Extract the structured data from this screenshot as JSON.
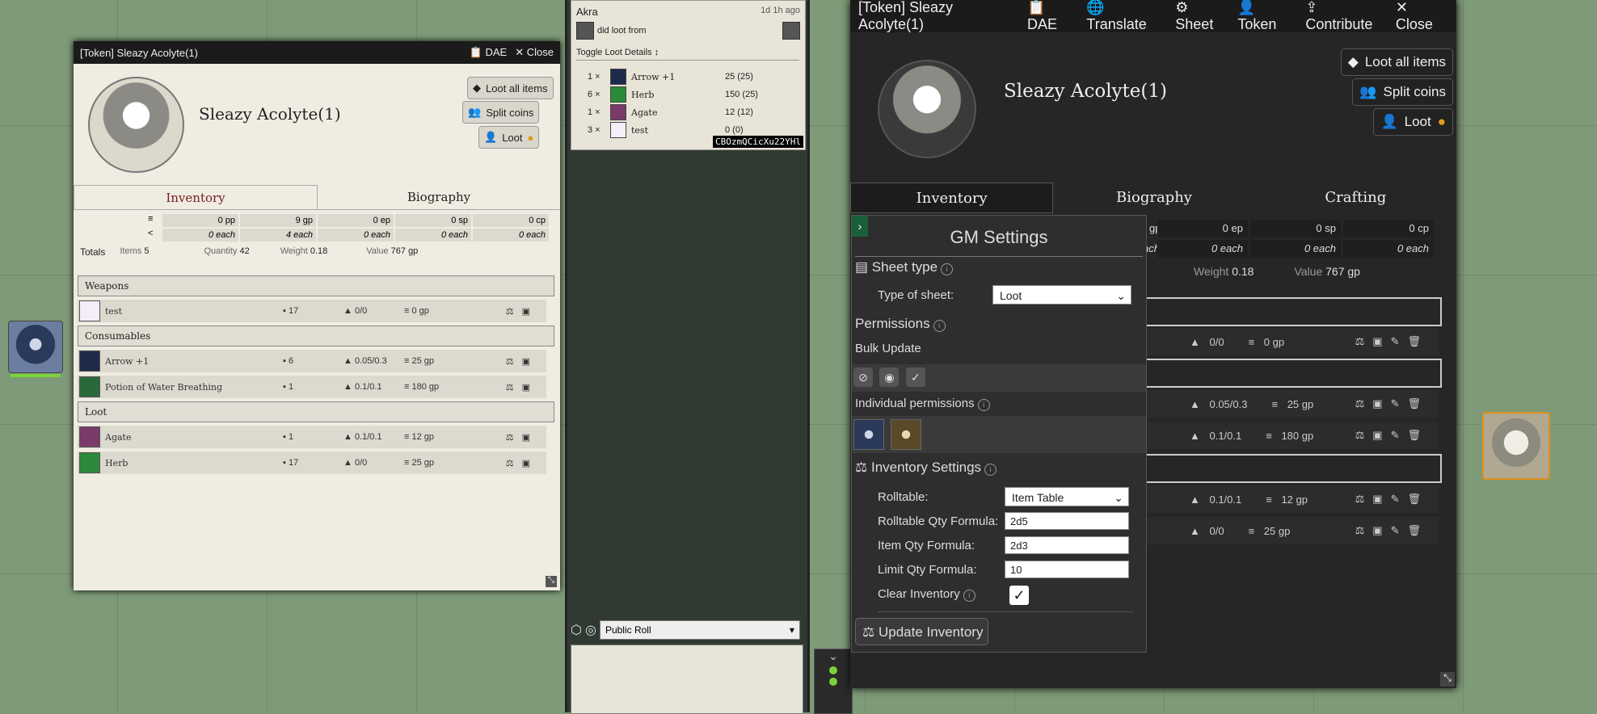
{
  "left_sheet": {
    "title": "[Token] Sleazy Acolyte(1)",
    "dae": "DAE",
    "close": "Close",
    "name": "Sleazy Acolyte(1)",
    "buttons": {
      "loot_all": "Loot all items",
      "split": "Split coins",
      "loot": "Loot"
    },
    "tabs": [
      "Inventory",
      "Biography"
    ],
    "coins": [
      {
        "value": "0",
        "unit": "pp",
        "each": "0 each"
      },
      {
        "value": "9",
        "unit": "gp",
        "each": "4 each"
      },
      {
        "value": "0",
        "unit": "ep",
        "each": "0 each"
      },
      {
        "value": "0",
        "unit": "sp",
        "each": "0 each"
      },
      {
        "value": "0",
        "unit": "cp",
        "each": "0 each"
      }
    ],
    "totals": {
      "label": "Totals",
      "items_label": "Items",
      "items": "5",
      "quantity_label": "Quantity",
      "quantity": "42",
      "weight_label": "Weight",
      "weight": "0.18",
      "value_label": "Value",
      "value": "767 gp"
    },
    "sections": {
      "weapons": "Weapons",
      "consumables": "Consumables",
      "loot": "Loot"
    },
    "items": [
      {
        "name": "test",
        "qty": "17",
        "weight": "0/0",
        "price": "0 gp"
      },
      {
        "name": "Arrow +1",
        "qty": "6",
        "weight": "0.05/0.3",
        "price": "25 gp"
      },
      {
        "name": "Potion of Water Breathing",
        "qty": "1",
        "weight": "0.1/0.1",
        "price": "180 gp"
      },
      {
        "name": "Agate",
        "qty": "1",
        "weight": "0.1/0.1",
        "price": "12 gp"
      },
      {
        "name": "Herb",
        "qty": "17",
        "weight": "0/0",
        "price": "25 gp"
      }
    ]
  },
  "chat": {
    "who": "Akra",
    "time": "1d 1h ago",
    "did": "did loot from",
    "toggle": "Toggle Loot Details ↕",
    "loot": [
      {
        "q": "1 ×",
        "name": "Arrow +1",
        "price": "25 (25)"
      },
      {
        "q": "6 ×",
        "name": "Herb",
        "price": "150 (25)"
      },
      {
        "q": "1 ×",
        "name": "Agate",
        "price": "12 (12)"
      },
      {
        "q": "3 ×",
        "name": "test",
        "price": "0 (0)"
      }
    ],
    "code": "CBOzmQCicXu22YHl",
    "roll_mode": "Public Roll"
  },
  "right_sheet": {
    "title": "[Token] Sleazy Acolyte(1)",
    "header_buttons": [
      "DAE",
      "Translate",
      "Sheet",
      "Token",
      "Contribute",
      "Close"
    ],
    "name": "Sleazy Acolyte(1)",
    "buttons": {
      "loot_all": "Loot all items",
      "split": "Split coins",
      "loot": "Loot"
    },
    "tabs": [
      "Inventory",
      "Biography",
      "Crafting"
    ],
    "coins": [
      {
        "value": "0",
        "unit": "ep"
      },
      {
        "value": "0",
        "unit": "sp"
      },
      {
        "value": "0",
        "unit": "cp"
      }
    ],
    "coin_partial": "gp",
    "each_partial": "ach",
    "each": "0 each",
    "weight_label": "Weight",
    "weight": "0.18",
    "value_label": "Value",
    "value": "767 gp",
    "rows": [
      {
        "weight": "0/0",
        "price": "0 gp"
      },
      {
        "weight": "0.05/0.3",
        "price": "25 gp"
      },
      {
        "weight": "0.1/0.1",
        "price": "180 gp"
      },
      {
        "weight": "0.1/0.1",
        "price": "12 gp"
      },
      {
        "weight": "0/0",
        "price": "25 gp"
      }
    ]
  },
  "gm": {
    "title": "GM Settings",
    "sheet_type": "Sheet type",
    "type_label": "Type of sheet:",
    "type_value": "Loot",
    "permissions": "Permissions",
    "bulk": "Bulk Update",
    "individual": "Individual permissions",
    "inventory_settings": "Inventory Settings",
    "rolltable_label": "Rolltable:",
    "rolltable_value": "Item Table",
    "rt_qty_label": "Rolltable Qty Formula:",
    "rt_qty": "2d5",
    "item_qty_label": "Item Qty Formula:",
    "item_qty": "2d3",
    "limit_label": "Limit Qty Formula:",
    "limit": "10",
    "clear_label": "Clear Inventory",
    "update": "Update Inventory"
  }
}
